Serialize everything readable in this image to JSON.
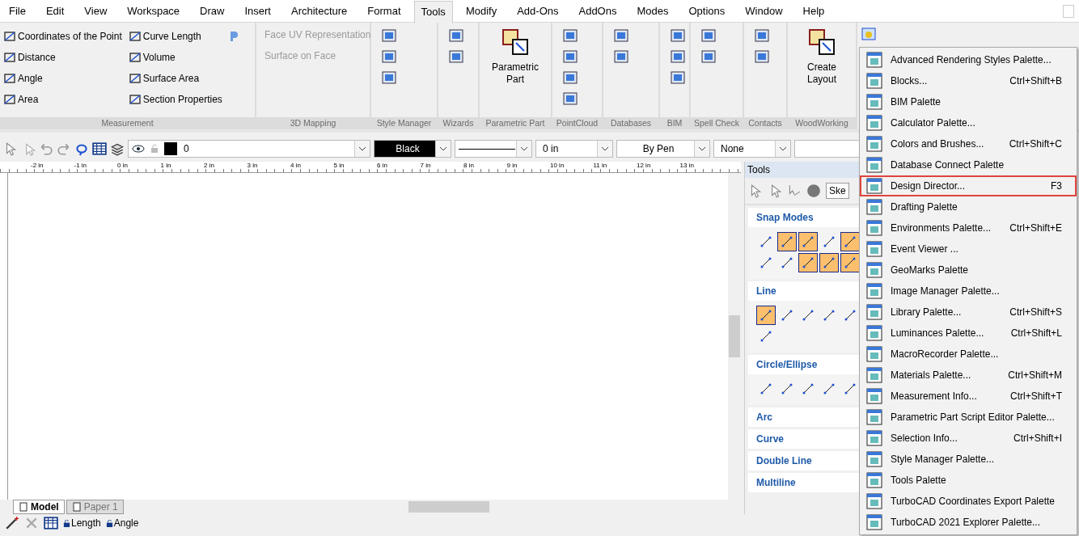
{
  "menu_bar": [
    {
      "label": "File",
      "selected": false
    },
    {
      "label": "Edit",
      "selected": false
    },
    {
      "label": "View",
      "selected": false
    },
    {
      "label": "Workspace",
      "selected": false
    },
    {
      "label": "Draw",
      "selected": false
    },
    {
      "label": "Insert",
      "selected": false
    },
    {
      "label": "Architecture",
      "selected": false
    },
    {
      "label": "Format",
      "selected": false
    },
    {
      "label": "Tools",
      "selected": true
    },
    {
      "label": "Modify",
      "selected": false
    },
    {
      "label": "Add-Ons",
      "selected": false
    },
    {
      "label": "AddOns",
      "selected": false
    },
    {
      "label": "Modes",
      "selected": false
    },
    {
      "label": "Options",
      "selected": false
    },
    {
      "label": "Window",
      "selected": false
    },
    {
      "label": "Help",
      "selected": false
    }
  ],
  "ribbon": {
    "groups": [
      {
        "title": "Measurement",
        "kind": "measure",
        "items": [
          {
            "label": "Coordinates of the Point",
            "disabled": false
          },
          {
            "label": "Distance",
            "disabled": false
          },
          {
            "label": "Angle",
            "disabled": false
          },
          {
            "label": "Area",
            "disabled": false
          },
          {
            "label": "Curve Length",
            "disabled": false
          },
          {
            "label": "Volume",
            "disabled": false
          },
          {
            "label": "Surface Area",
            "disabled": false
          },
          {
            "label": "Section Properties",
            "disabled": false
          }
        ]
      },
      {
        "title": "3D Mapping",
        "kind": "text",
        "items": [
          {
            "label": "Face UV Representation",
            "disabled": true
          },
          {
            "label": "Surface on Face",
            "disabled": true
          }
        ]
      },
      {
        "title": "Style Manager",
        "kind": "icons"
      },
      {
        "title": "Wizards",
        "kind": "icons"
      },
      {
        "title": "Parametric Part",
        "kind": "large",
        "label": "Parametric Part"
      },
      {
        "title": "PointCloud",
        "kind": "icons"
      },
      {
        "title": "Databases",
        "kind": "icons"
      },
      {
        "title": "BIM",
        "kind": "icons"
      },
      {
        "title": "Spell Check",
        "kind": "icons"
      },
      {
        "title": "Contacts",
        "kind": "icons"
      },
      {
        "title": "WoodWorking",
        "kind": "large",
        "label": "Create Layout"
      }
    ]
  },
  "toolbar": {
    "combos": [
      {
        "kind": "layer",
        "value": "0"
      },
      {
        "kind": "dark",
        "value": "Black"
      },
      {
        "kind": "line"
      },
      {
        "kind": "text",
        "value": "0 in"
      },
      {
        "kind": "center",
        "value": "By Pen"
      },
      {
        "kind": "text",
        "value": "None"
      }
    ]
  },
  "ruler": [
    "-2 in",
    "-1 in",
    "0 in",
    "1 in",
    "2 in",
    "3 in",
    "4 in",
    "5 in",
    "6 in",
    "7 in",
    "8 in",
    "9 in",
    "10 in",
    "11 in",
    "12 in",
    "13 in"
  ],
  "tools_panel": {
    "title": "Tools",
    "combo_value": "Ske",
    "sections": [
      {
        "title": "Snap Modes",
        "buttons": [
          {
            "active": false
          },
          {
            "active": true
          },
          {
            "active": true
          },
          {
            "active": false
          },
          {
            "active": true
          },
          {
            "active": false
          },
          {
            "active": false
          },
          {
            "active": true
          },
          {
            "active": true
          },
          {
            "active": true
          }
        ]
      },
      {
        "title": "Line",
        "buttons": [
          {
            "active": true
          },
          {
            "active": false
          },
          {
            "active": false
          },
          {
            "active": false
          },
          {
            "active": false
          },
          {
            "active": false
          }
        ]
      },
      {
        "title": "Circle/Ellipse",
        "buttons": [
          {
            "active": false
          },
          {
            "active": false
          },
          {
            "active": false
          },
          {
            "active": false
          },
          {
            "active": false
          }
        ]
      },
      {
        "title": "Arc"
      },
      {
        "title": "Curve"
      },
      {
        "title": "Double Line"
      },
      {
        "title": "Multiline"
      }
    ]
  },
  "sheet_tabs": [
    {
      "label": "Model",
      "selected": true
    },
    {
      "label": "Paper 1",
      "selected": false
    }
  ],
  "status_bar": {
    "fields": [
      {
        "label": "Length"
      },
      {
        "label": "Angle"
      }
    ]
  },
  "dropdown_menu": [
    {
      "label": "Advanced Rendering Styles Palette...",
      "highlighted": false
    },
    {
      "label": "Blocks...",
      "shortcut": "Ctrl+Shift+B",
      "highlighted": false
    },
    {
      "label": "BIM Palette",
      "highlighted": false
    },
    {
      "label": "Calculator Palette...",
      "highlighted": false
    },
    {
      "label": "Colors and Brushes...",
      "shortcut": "Ctrl+Shift+C",
      "highlighted": false
    },
    {
      "label": "Database Connect Palette",
      "highlighted": false
    },
    {
      "label": "Design Director...",
      "shortcut": "F3",
      "highlighted": true
    },
    {
      "label": "Drafting Palette",
      "highlighted": false
    },
    {
      "label": "Environments Palette...",
      "shortcut": "Ctrl+Shift+E",
      "highlighted": false
    },
    {
      "label": "Event Viewer ...",
      "highlighted": false
    },
    {
      "label": "GeoMarks Palette",
      "highlighted": false
    },
    {
      "label": "Image Manager Palette...",
      "highlighted": false
    },
    {
      "label": "Library Palette...",
      "shortcut": "Ctrl+Shift+S",
      "highlighted": false
    },
    {
      "label": "Luminances Palette...",
      "shortcut": "Ctrl+Shift+L",
      "highlighted": false
    },
    {
      "label": "MacroRecorder Palette...",
      "highlighted": false
    },
    {
      "label": "Materials Palette...",
      "shortcut": "Ctrl+Shift+M",
      "highlighted": false
    },
    {
      "label": "Measurement Info...",
      "shortcut": "Ctrl+Shift+T",
      "highlighted": false
    },
    {
      "label": "Parametric Part Script Editor Palette...",
      "highlighted": false
    },
    {
      "label": "Selection Info...",
      "shortcut": "Ctrl+Shift+I",
      "highlighted": false
    },
    {
      "label": "Style Manager Palette...",
      "highlighted": false
    },
    {
      "label": "Tools Palette",
      "highlighted": false
    },
    {
      "label": "TurboCAD Coordinates Export Palette",
      "highlighted": false
    },
    {
      "label": "TurboCAD 2021 Explorer Palette...",
      "highlighted": false
    }
  ]
}
